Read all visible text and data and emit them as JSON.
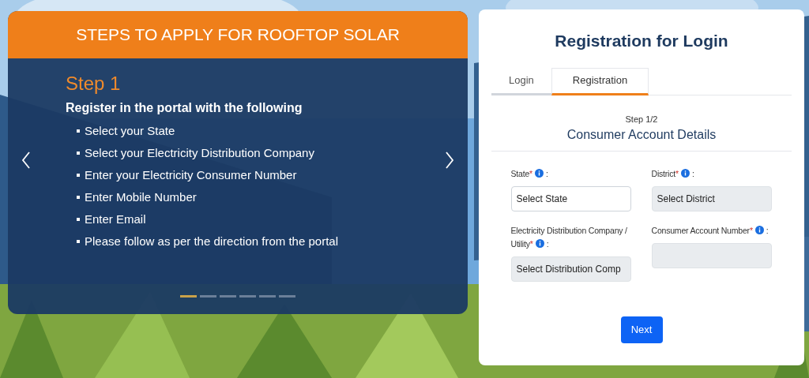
{
  "steps_card": {
    "title": "STEPS TO APPLY FOR ROOFTOP SOLAR",
    "step": "Step 1",
    "intro": "Register in the portal with the following",
    "bullets": [
      "Select your State",
      "Select your Electricity Distribution Company",
      "Enter your Electricity Consumer Number",
      "Enter Mobile Number",
      "Enter Email",
      "Please follow as per the direction from the portal"
    ],
    "indicators": [
      {
        "selected": true
      },
      {
        "selected": false
      },
      {
        "selected": false
      },
      {
        "selected": false
      },
      {
        "selected": false
      },
      {
        "selected": false
      }
    ]
  },
  "form": {
    "title": "Registration for Login",
    "tabs": [
      {
        "label": "Login",
        "selected": false
      },
      {
        "label": "Registration",
        "selected": true
      }
    ],
    "step": "Step 1/2",
    "section": "Consumer Account Details",
    "fields": [
      {
        "label": "State",
        "colon": ":",
        "placeholder": "Select State",
        "disabled": false
      },
      {
        "label": "District",
        "colon": ":",
        "placeholder": "Select District",
        "disabled": true
      },
      {
        "label": "Electricity Distribution Company / Utility",
        "colon": ":",
        "placeholder": "Select Distribution Comp",
        "disabled": true
      },
      {
        "label": "Consumer Account Number",
        "colon": ":",
        "disabled": true
      }
    ],
    "required_mark": "*",
    "button": "Next"
  }
}
